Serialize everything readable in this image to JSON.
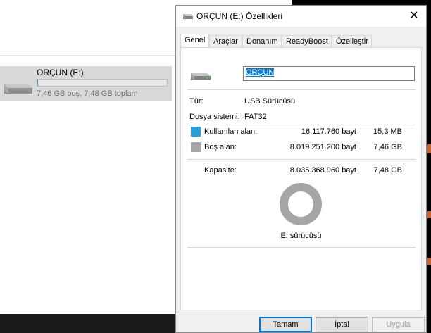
{
  "explorer": {
    "drive_name": "ORÇUN (E:)",
    "drive_summary": "7,46 GB boş, 7,48 GB toplam",
    "used_fraction": 0.002,
    "bar_color": "#26a0da"
  },
  "dialog": {
    "title": "ORÇUN (E:) Özellikleri",
    "close_glyph": "✕",
    "tabs": [
      {
        "label": "Genel",
        "active": true
      },
      {
        "label": "Araçlar"
      },
      {
        "label": "Donanım"
      },
      {
        "label": "ReadyBoost"
      },
      {
        "label": "Özelleştir"
      }
    ],
    "volume_label": "ORÇUN",
    "type_label": "Tür:",
    "type_value": "USB Sürücüsü",
    "fs_label": "Dosya sistemi:",
    "fs_value": "FAT32",
    "used_label": "Kullanılan alan:",
    "used_bytes": "16.117.760 bayt",
    "used_size": "15,3 MB",
    "used_color": "#26a0da",
    "free_label": "Boş alan:",
    "free_bytes": "8.019.251.200 bayt",
    "free_size": "7,46 GB",
    "free_color": "#a6a6a6",
    "capacity_label": "Kapasite:",
    "capacity_bytes": "8.035.368.960 bayt",
    "capacity_size": "7,48 GB",
    "drive_caption": "E: sürücüsü",
    "buttons": {
      "ok": "Tamam",
      "cancel": "İptal",
      "apply": "Uygula"
    }
  },
  "icons": {
    "drive": "usb-drive-icon",
    "close": "close-icon"
  }
}
